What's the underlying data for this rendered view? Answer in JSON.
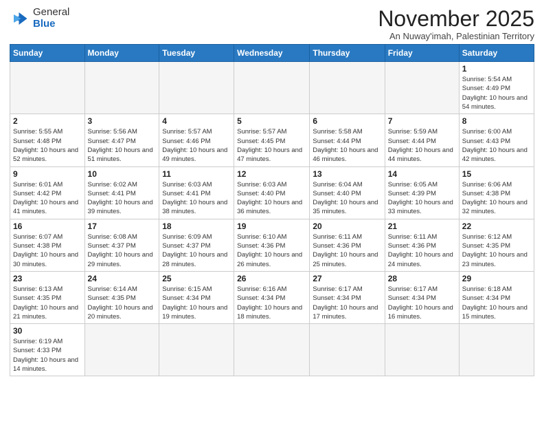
{
  "header": {
    "logo_general": "General",
    "logo_blue": "Blue",
    "month_title": "November 2025",
    "subtitle": "An Nuway'imah, Palestinian Territory"
  },
  "weekdays": [
    "Sunday",
    "Monday",
    "Tuesday",
    "Wednesday",
    "Thursday",
    "Friday",
    "Saturday"
  ],
  "weeks": [
    [
      {
        "day": "",
        "info": ""
      },
      {
        "day": "",
        "info": ""
      },
      {
        "day": "",
        "info": ""
      },
      {
        "day": "",
        "info": ""
      },
      {
        "day": "",
        "info": ""
      },
      {
        "day": "",
        "info": ""
      },
      {
        "day": "1",
        "info": "Sunrise: 5:54 AM\nSunset: 4:49 PM\nDaylight: 10 hours\nand 54 minutes."
      }
    ],
    [
      {
        "day": "2",
        "info": "Sunrise: 5:55 AM\nSunset: 4:48 PM\nDaylight: 10 hours\nand 52 minutes."
      },
      {
        "day": "3",
        "info": "Sunrise: 5:56 AM\nSunset: 4:47 PM\nDaylight: 10 hours\nand 51 minutes."
      },
      {
        "day": "4",
        "info": "Sunrise: 5:57 AM\nSunset: 4:46 PM\nDaylight: 10 hours\nand 49 minutes."
      },
      {
        "day": "5",
        "info": "Sunrise: 5:57 AM\nSunset: 4:45 PM\nDaylight: 10 hours\nand 47 minutes."
      },
      {
        "day": "6",
        "info": "Sunrise: 5:58 AM\nSunset: 4:44 PM\nDaylight: 10 hours\nand 46 minutes."
      },
      {
        "day": "7",
        "info": "Sunrise: 5:59 AM\nSunset: 4:44 PM\nDaylight: 10 hours\nand 44 minutes."
      },
      {
        "day": "8",
        "info": "Sunrise: 6:00 AM\nSunset: 4:43 PM\nDaylight: 10 hours\nand 42 minutes."
      }
    ],
    [
      {
        "day": "9",
        "info": "Sunrise: 6:01 AM\nSunset: 4:42 PM\nDaylight: 10 hours\nand 41 minutes."
      },
      {
        "day": "10",
        "info": "Sunrise: 6:02 AM\nSunset: 4:41 PM\nDaylight: 10 hours\nand 39 minutes."
      },
      {
        "day": "11",
        "info": "Sunrise: 6:03 AM\nSunset: 4:41 PM\nDaylight: 10 hours\nand 38 minutes."
      },
      {
        "day": "12",
        "info": "Sunrise: 6:03 AM\nSunset: 4:40 PM\nDaylight: 10 hours\nand 36 minutes."
      },
      {
        "day": "13",
        "info": "Sunrise: 6:04 AM\nSunset: 4:40 PM\nDaylight: 10 hours\nand 35 minutes."
      },
      {
        "day": "14",
        "info": "Sunrise: 6:05 AM\nSunset: 4:39 PM\nDaylight: 10 hours\nand 33 minutes."
      },
      {
        "day": "15",
        "info": "Sunrise: 6:06 AM\nSunset: 4:38 PM\nDaylight: 10 hours\nand 32 minutes."
      }
    ],
    [
      {
        "day": "16",
        "info": "Sunrise: 6:07 AM\nSunset: 4:38 PM\nDaylight: 10 hours\nand 30 minutes."
      },
      {
        "day": "17",
        "info": "Sunrise: 6:08 AM\nSunset: 4:37 PM\nDaylight: 10 hours\nand 29 minutes."
      },
      {
        "day": "18",
        "info": "Sunrise: 6:09 AM\nSunset: 4:37 PM\nDaylight: 10 hours\nand 28 minutes."
      },
      {
        "day": "19",
        "info": "Sunrise: 6:10 AM\nSunset: 4:36 PM\nDaylight: 10 hours\nand 26 minutes."
      },
      {
        "day": "20",
        "info": "Sunrise: 6:11 AM\nSunset: 4:36 PM\nDaylight: 10 hours\nand 25 minutes."
      },
      {
        "day": "21",
        "info": "Sunrise: 6:11 AM\nSunset: 4:36 PM\nDaylight: 10 hours\nand 24 minutes."
      },
      {
        "day": "22",
        "info": "Sunrise: 6:12 AM\nSunset: 4:35 PM\nDaylight: 10 hours\nand 23 minutes."
      }
    ],
    [
      {
        "day": "23",
        "info": "Sunrise: 6:13 AM\nSunset: 4:35 PM\nDaylight: 10 hours\nand 21 minutes."
      },
      {
        "day": "24",
        "info": "Sunrise: 6:14 AM\nSunset: 4:35 PM\nDaylight: 10 hours\nand 20 minutes."
      },
      {
        "day": "25",
        "info": "Sunrise: 6:15 AM\nSunset: 4:34 PM\nDaylight: 10 hours\nand 19 minutes."
      },
      {
        "day": "26",
        "info": "Sunrise: 6:16 AM\nSunset: 4:34 PM\nDaylight: 10 hours\nand 18 minutes."
      },
      {
        "day": "27",
        "info": "Sunrise: 6:17 AM\nSunset: 4:34 PM\nDaylight: 10 hours\nand 17 minutes."
      },
      {
        "day": "28",
        "info": "Sunrise: 6:17 AM\nSunset: 4:34 PM\nDaylight: 10 hours\nand 16 minutes."
      },
      {
        "day": "29",
        "info": "Sunrise: 6:18 AM\nSunset: 4:34 PM\nDaylight: 10 hours\nand 15 minutes."
      }
    ],
    [
      {
        "day": "30",
        "info": "Sunrise: 6:19 AM\nSunset: 4:33 PM\nDaylight: 10 hours\nand 14 minutes."
      },
      {
        "day": "",
        "info": ""
      },
      {
        "day": "",
        "info": ""
      },
      {
        "day": "",
        "info": ""
      },
      {
        "day": "",
        "info": ""
      },
      {
        "day": "",
        "info": ""
      },
      {
        "day": "",
        "info": ""
      }
    ]
  ]
}
